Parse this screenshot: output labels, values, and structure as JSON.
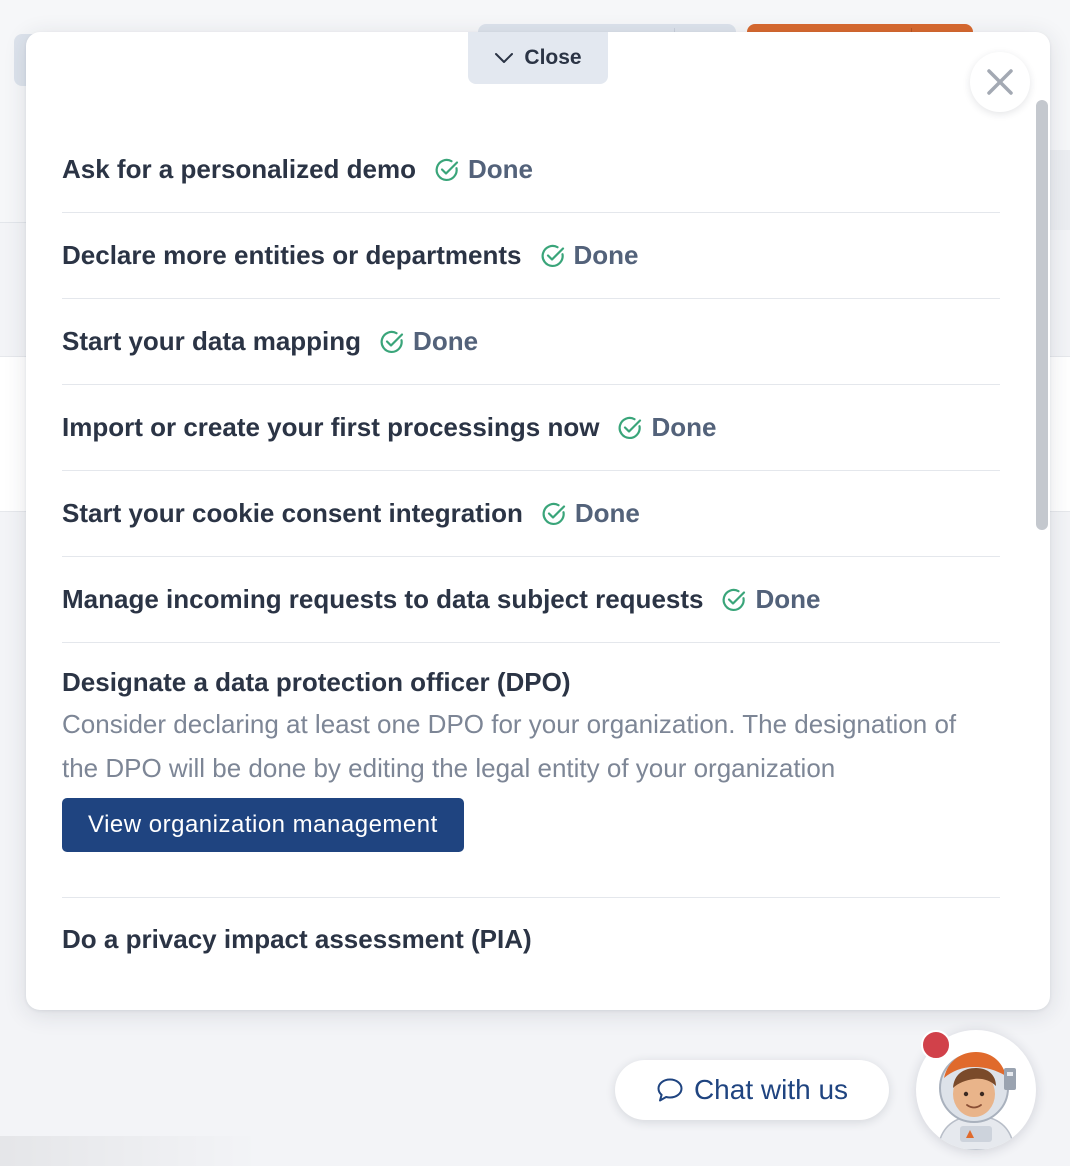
{
  "header": {
    "close_tab_label": "Close"
  },
  "tasks": [
    {
      "title": "Ask for a personalized demo",
      "status": "Done"
    },
    {
      "title": "Declare more entities or departments",
      "status": "Done"
    },
    {
      "title": "Start your data mapping",
      "status": "Done"
    },
    {
      "title": "Import or create your first processings now",
      "status": "Done"
    },
    {
      "title": "Start your cookie consent integration",
      "status": "Done"
    },
    {
      "title": "Manage incoming requests to data subject requests",
      "status": "Done"
    }
  ],
  "expanded_task": {
    "title": "Designate a data protection officer (DPO)",
    "description": "Consider declaring at least one DPO for your organization. The designation of the DPO will be done by editing the legal entity of your organization",
    "button_label": "View organization management"
  },
  "next_task": {
    "title": "Do a privacy impact assessment (PIA)"
  },
  "chat": {
    "label": "Chat with us"
  },
  "colors": {
    "primary": "#1f4480",
    "done_check": "#3aa57a",
    "notification": "#d1414a",
    "accent_orange": "#d8692f"
  }
}
